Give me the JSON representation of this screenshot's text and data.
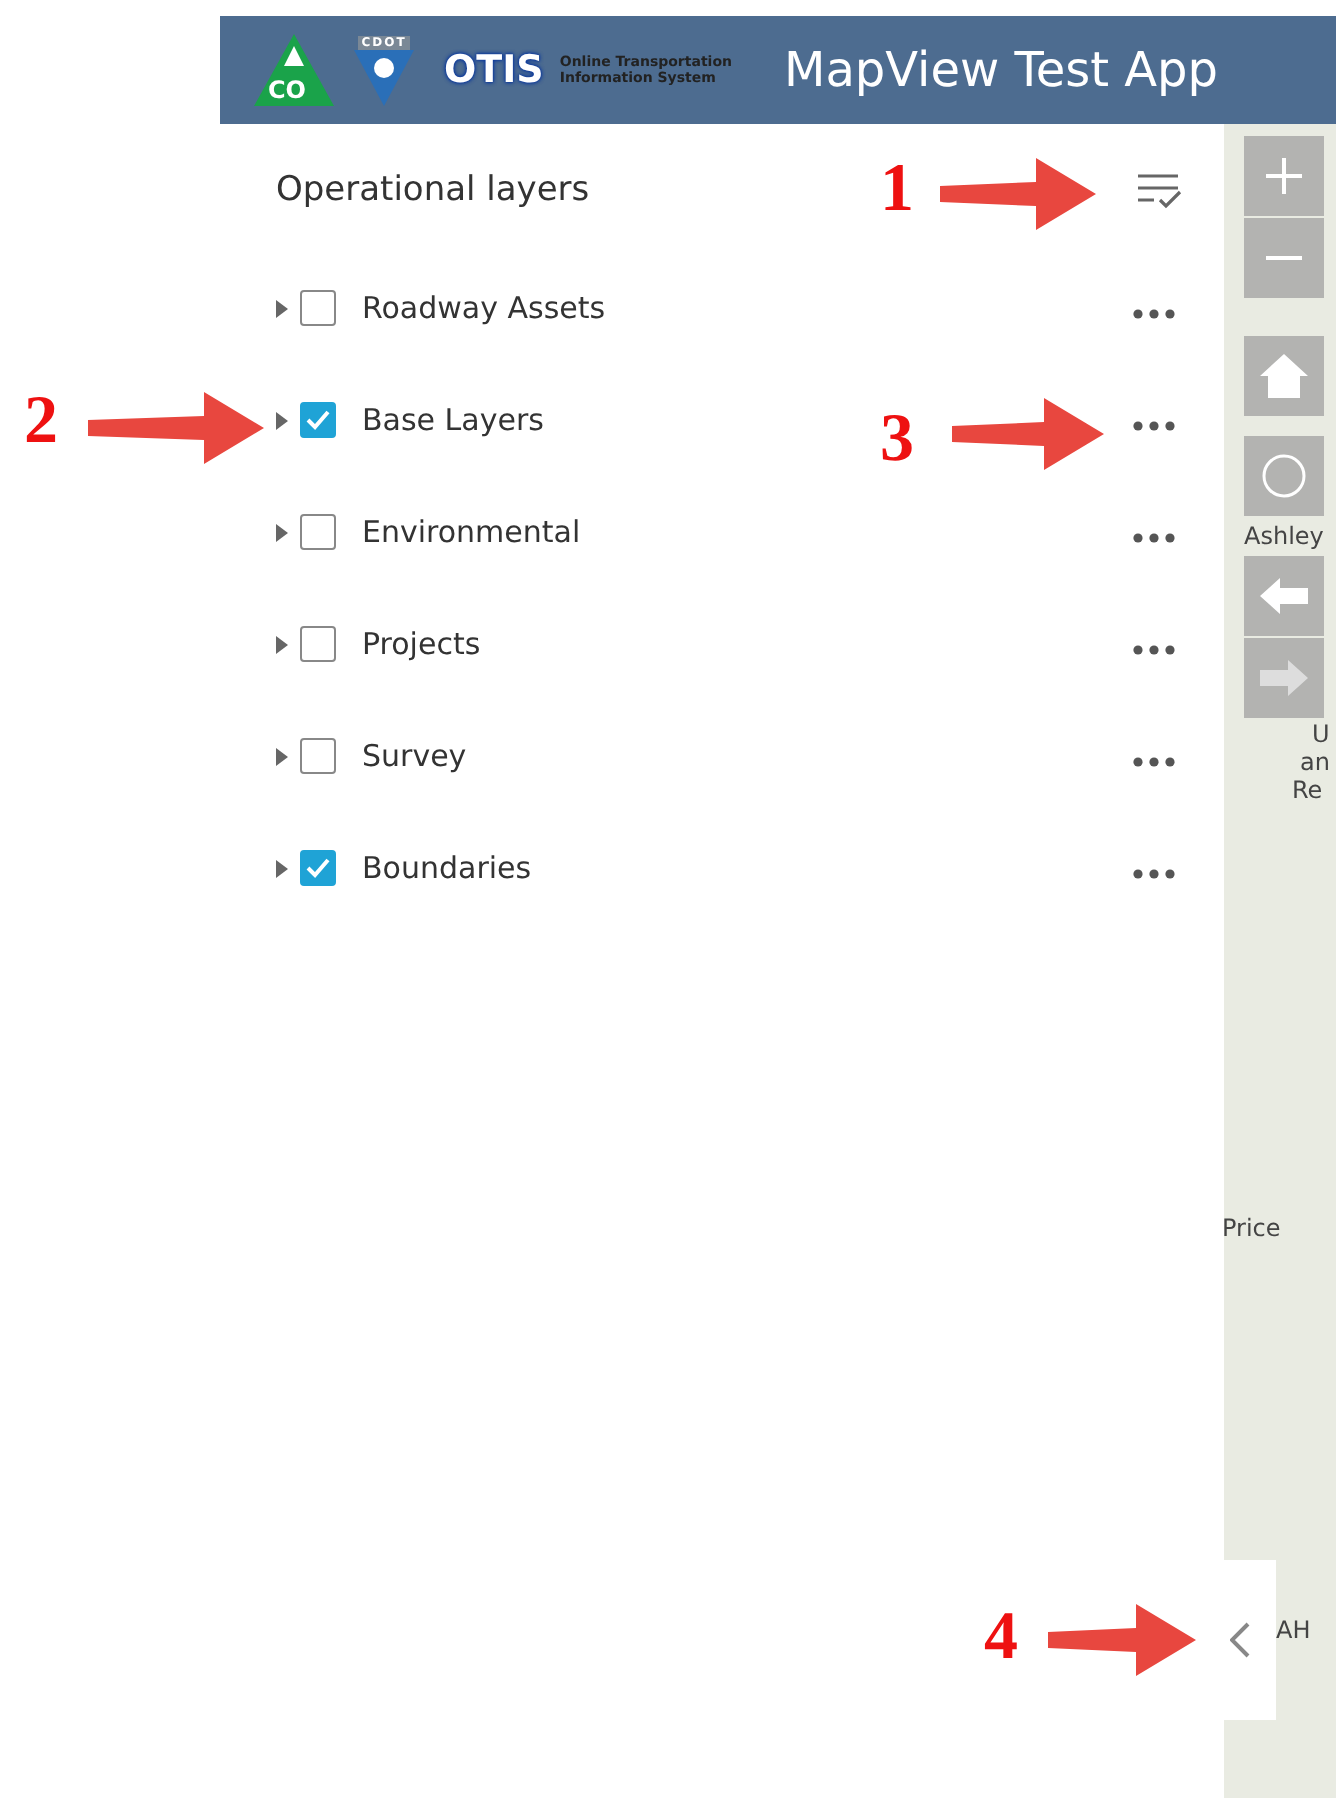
{
  "header": {
    "logo_state": "CO",
    "logo_agency": "CDOT",
    "brand": "OTIS",
    "brand_line_1": "Online Transportation",
    "brand_line_2": "Information System",
    "title": "MapView Test App"
  },
  "panel": {
    "title": "Operational layers",
    "layers": [
      {
        "label": "Roadway Assets",
        "checked": false
      },
      {
        "label": "Base Layers",
        "checked": true
      },
      {
        "label": "Environmental",
        "checked": false
      },
      {
        "label": "Projects",
        "checked": false
      },
      {
        "label": "Survey",
        "checked": false
      },
      {
        "label": "Boundaries",
        "checked": true
      }
    ]
  },
  "map": {
    "labels": [
      "Ashley",
      "U",
      "an",
      "Re",
      "Price",
      "AH"
    ]
  },
  "annotations": [
    "1",
    "2",
    "3",
    "4"
  ]
}
